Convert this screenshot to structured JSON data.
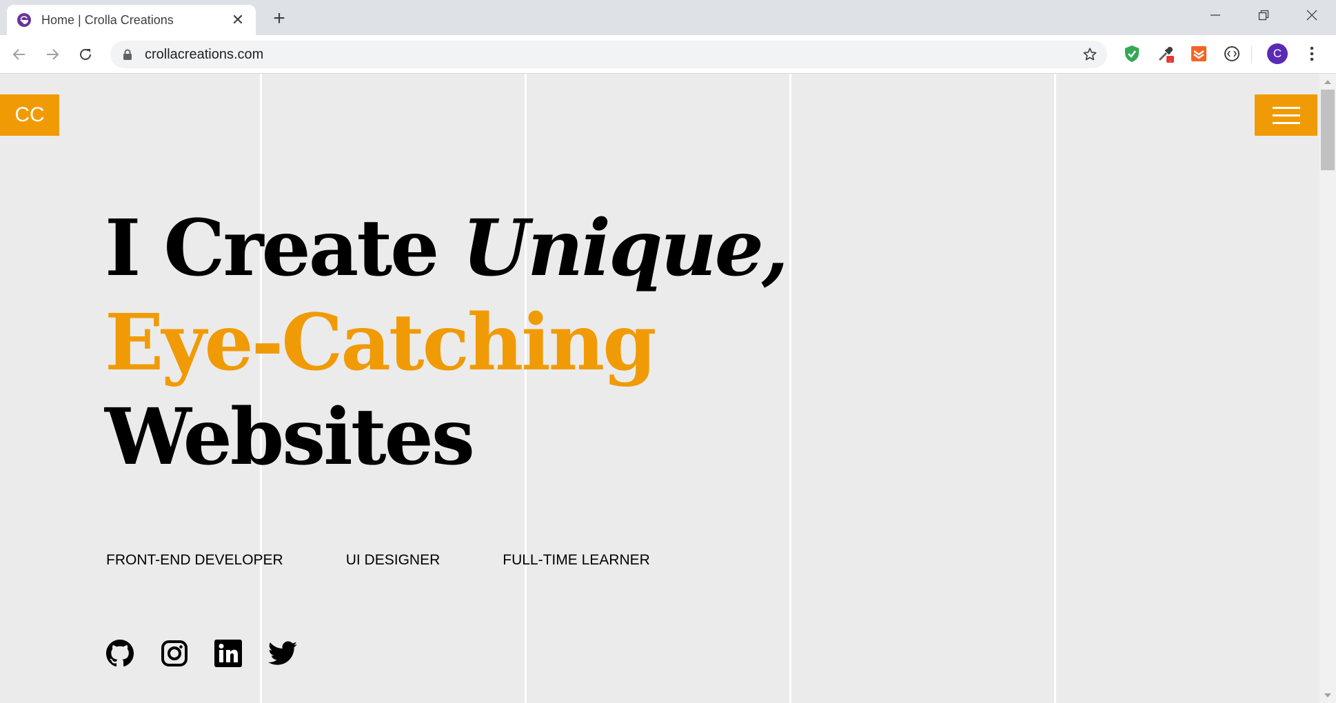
{
  "browser": {
    "tab_title": "Home | Crolla Creations",
    "url": "crollacreations.com",
    "profile_initial": "C"
  },
  "page": {
    "logo_text": "CC",
    "hero": {
      "line1_plain": "I Create",
      "line1_italic": "Unique,",
      "line2": "Eye-Catching",
      "line3": "Websites"
    },
    "roles": [
      "FRONT-END DEVELOPER",
      "UI DESIGNER",
      "FULL-TIME LEARNER"
    ],
    "social": [
      "github-icon",
      "instagram-icon",
      "linkedin-icon",
      "twitter-icon"
    ]
  },
  "colors": {
    "accent": "#f09b05",
    "background": "#ebebeb",
    "text": "#000000"
  }
}
